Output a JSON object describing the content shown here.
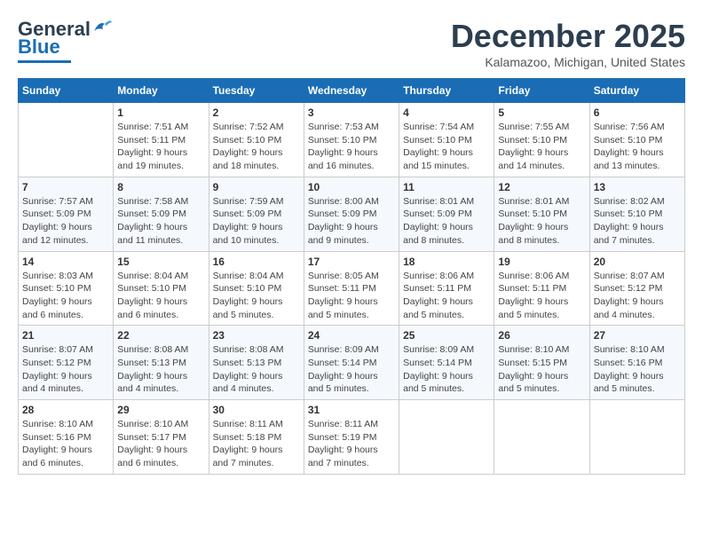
{
  "header": {
    "logo_line1": "General",
    "logo_line2": "Blue",
    "month": "December 2025",
    "location": "Kalamazoo, Michigan, United States"
  },
  "weekdays": [
    "Sunday",
    "Monday",
    "Tuesday",
    "Wednesday",
    "Thursday",
    "Friday",
    "Saturday"
  ],
  "weeks": [
    [
      {
        "day": "",
        "sunrise": "",
        "sunset": "",
        "daylight": ""
      },
      {
        "day": "1",
        "sunrise": "Sunrise: 7:51 AM",
        "sunset": "Sunset: 5:11 PM",
        "daylight": "Daylight: 9 hours and 19 minutes."
      },
      {
        "day": "2",
        "sunrise": "Sunrise: 7:52 AM",
        "sunset": "Sunset: 5:10 PM",
        "daylight": "Daylight: 9 hours and 18 minutes."
      },
      {
        "day": "3",
        "sunrise": "Sunrise: 7:53 AM",
        "sunset": "Sunset: 5:10 PM",
        "daylight": "Daylight: 9 hours and 16 minutes."
      },
      {
        "day": "4",
        "sunrise": "Sunrise: 7:54 AM",
        "sunset": "Sunset: 5:10 PM",
        "daylight": "Daylight: 9 hours and 15 minutes."
      },
      {
        "day": "5",
        "sunrise": "Sunrise: 7:55 AM",
        "sunset": "Sunset: 5:10 PM",
        "daylight": "Daylight: 9 hours and 14 minutes."
      },
      {
        "day": "6",
        "sunrise": "Sunrise: 7:56 AM",
        "sunset": "Sunset: 5:10 PM",
        "daylight": "Daylight: 9 hours and 13 minutes."
      }
    ],
    [
      {
        "day": "7",
        "sunrise": "Sunrise: 7:57 AM",
        "sunset": "Sunset: 5:09 PM",
        "daylight": "Daylight: 9 hours and 12 minutes."
      },
      {
        "day": "8",
        "sunrise": "Sunrise: 7:58 AM",
        "sunset": "Sunset: 5:09 PM",
        "daylight": "Daylight: 9 hours and 11 minutes."
      },
      {
        "day": "9",
        "sunrise": "Sunrise: 7:59 AM",
        "sunset": "Sunset: 5:09 PM",
        "daylight": "Daylight: 9 hours and 10 minutes."
      },
      {
        "day": "10",
        "sunrise": "Sunrise: 8:00 AM",
        "sunset": "Sunset: 5:09 PM",
        "daylight": "Daylight: 9 hours and 9 minutes."
      },
      {
        "day": "11",
        "sunrise": "Sunrise: 8:01 AM",
        "sunset": "Sunset: 5:09 PM",
        "daylight": "Daylight: 9 hours and 8 minutes."
      },
      {
        "day": "12",
        "sunrise": "Sunrise: 8:01 AM",
        "sunset": "Sunset: 5:10 PM",
        "daylight": "Daylight: 9 hours and 8 minutes."
      },
      {
        "day": "13",
        "sunrise": "Sunrise: 8:02 AM",
        "sunset": "Sunset: 5:10 PM",
        "daylight": "Daylight: 9 hours and 7 minutes."
      }
    ],
    [
      {
        "day": "14",
        "sunrise": "Sunrise: 8:03 AM",
        "sunset": "Sunset: 5:10 PM",
        "daylight": "Daylight: 9 hours and 6 minutes."
      },
      {
        "day": "15",
        "sunrise": "Sunrise: 8:04 AM",
        "sunset": "Sunset: 5:10 PM",
        "daylight": "Daylight: 9 hours and 6 minutes."
      },
      {
        "day": "16",
        "sunrise": "Sunrise: 8:04 AM",
        "sunset": "Sunset: 5:10 PM",
        "daylight": "Daylight: 9 hours and 5 minutes."
      },
      {
        "day": "17",
        "sunrise": "Sunrise: 8:05 AM",
        "sunset": "Sunset: 5:11 PM",
        "daylight": "Daylight: 9 hours and 5 minutes."
      },
      {
        "day": "18",
        "sunrise": "Sunrise: 8:06 AM",
        "sunset": "Sunset: 5:11 PM",
        "daylight": "Daylight: 9 hours and 5 minutes."
      },
      {
        "day": "19",
        "sunrise": "Sunrise: 8:06 AM",
        "sunset": "Sunset: 5:11 PM",
        "daylight": "Daylight: 9 hours and 5 minutes."
      },
      {
        "day": "20",
        "sunrise": "Sunrise: 8:07 AM",
        "sunset": "Sunset: 5:12 PM",
        "daylight": "Daylight: 9 hours and 4 minutes."
      }
    ],
    [
      {
        "day": "21",
        "sunrise": "Sunrise: 8:07 AM",
        "sunset": "Sunset: 5:12 PM",
        "daylight": "Daylight: 9 hours and 4 minutes."
      },
      {
        "day": "22",
        "sunrise": "Sunrise: 8:08 AM",
        "sunset": "Sunset: 5:13 PM",
        "daylight": "Daylight: 9 hours and 4 minutes."
      },
      {
        "day": "23",
        "sunrise": "Sunrise: 8:08 AM",
        "sunset": "Sunset: 5:13 PM",
        "daylight": "Daylight: 9 hours and 4 minutes."
      },
      {
        "day": "24",
        "sunrise": "Sunrise: 8:09 AM",
        "sunset": "Sunset: 5:14 PM",
        "daylight": "Daylight: 9 hours and 5 minutes."
      },
      {
        "day": "25",
        "sunrise": "Sunrise: 8:09 AM",
        "sunset": "Sunset: 5:14 PM",
        "daylight": "Daylight: 9 hours and 5 minutes."
      },
      {
        "day": "26",
        "sunrise": "Sunrise: 8:10 AM",
        "sunset": "Sunset: 5:15 PM",
        "daylight": "Daylight: 9 hours and 5 minutes."
      },
      {
        "day": "27",
        "sunrise": "Sunrise: 8:10 AM",
        "sunset": "Sunset: 5:16 PM",
        "daylight": "Daylight: 9 hours and 5 minutes."
      }
    ],
    [
      {
        "day": "28",
        "sunrise": "Sunrise: 8:10 AM",
        "sunset": "Sunset: 5:16 PM",
        "daylight": "Daylight: 9 hours and 6 minutes."
      },
      {
        "day": "29",
        "sunrise": "Sunrise: 8:10 AM",
        "sunset": "Sunset: 5:17 PM",
        "daylight": "Daylight: 9 hours and 6 minutes."
      },
      {
        "day": "30",
        "sunrise": "Sunrise: 8:11 AM",
        "sunset": "Sunset: 5:18 PM",
        "daylight": "Daylight: 9 hours and 7 minutes."
      },
      {
        "day": "31",
        "sunrise": "Sunrise: 8:11 AM",
        "sunset": "Sunset: 5:19 PM",
        "daylight": "Daylight: 9 hours and 7 minutes."
      },
      {
        "day": "",
        "sunrise": "",
        "sunset": "",
        "daylight": ""
      },
      {
        "day": "",
        "sunrise": "",
        "sunset": "",
        "daylight": ""
      },
      {
        "day": "",
        "sunrise": "",
        "sunset": "",
        "daylight": ""
      }
    ]
  ]
}
